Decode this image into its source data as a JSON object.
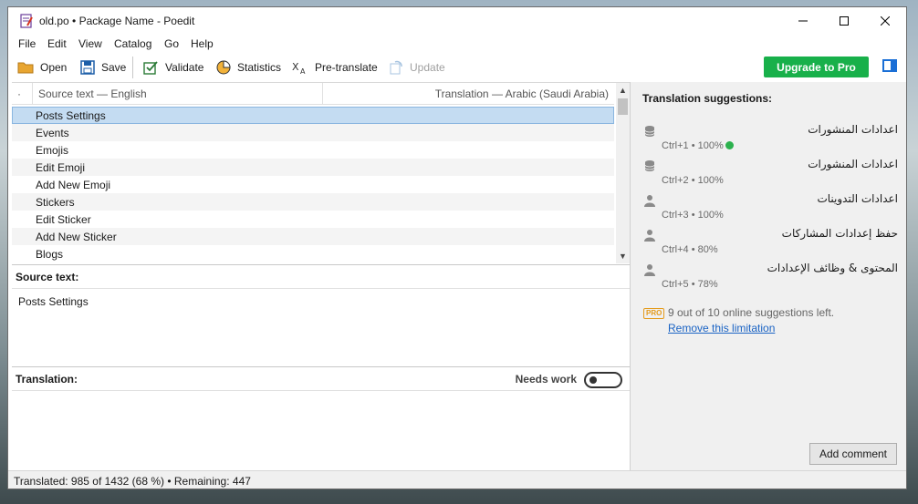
{
  "window": {
    "title": "old.po • Package Name - Poedit"
  },
  "menu": [
    "File",
    "Edit",
    "View",
    "Catalog",
    "Go",
    "Help"
  ],
  "toolbar": {
    "open": "Open",
    "save": "Save",
    "validate": "Validate",
    "statistics": "Statistics",
    "pretranslate": "Pre-translate",
    "update": "Update",
    "upgrade": "Upgrade to Pro"
  },
  "list": {
    "dot": "·",
    "source_header": "Source text — English",
    "translation_header": "Translation — Arabic (Saudi Arabia)",
    "rows": [
      "Posts Settings",
      "Events",
      "Emojis",
      "Edit Emoji",
      "Add New Emoji",
      "Stickers",
      "Edit Sticker",
      "Add New Sticker",
      "Blogs"
    ]
  },
  "source_panel": {
    "label": "Source text:",
    "text": "Posts Settings"
  },
  "translation_panel": {
    "label": "Translation:",
    "needs_work": "Needs work"
  },
  "status": {
    "text": "Translated: 985 of 1432 (68 %)  •  Remaining: 447"
  },
  "sidebar": {
    "title": "Translation suggestions:",
    "suggestions": [
      {
        "text": "اعدادات المنشورات",
        "meta": "Ctrl+1 • 100%",
        "icon": "database-icon"
      },
      {
        "text": "اعدادات المنشورات",
        "meta": "Ctrl+2 • 100%",
        "icon": "database-icon"
      },
      {
        "text": "اعدادات التدوينات",
        "meta": "Ctrl+3 • 100%",
        "icon": "person-icon"
      },
      {
        "text": "حفظ إعدادات المشاركات",
        "meta": "Ctrl+4 • 80%",
        "icon": "person-icon"
      },
      {
        "text": "المحتوى & وظائف الإعدادات",
        "meta": "Ctrl+5 • 78%",
        "icon": "person-icon"
      }
    ],
    "pro_badge": "PRO",
    "online_left": "9 out of 10 online suggestions left.",
    "remove_link": "Remove this limitation",
    "add_comment": "Add comment"
  },
  "colors": {
    "accent": "#18b04a",
    "selection": "#c4dcf2",
    "link": "#1a63c4"
  }
}
